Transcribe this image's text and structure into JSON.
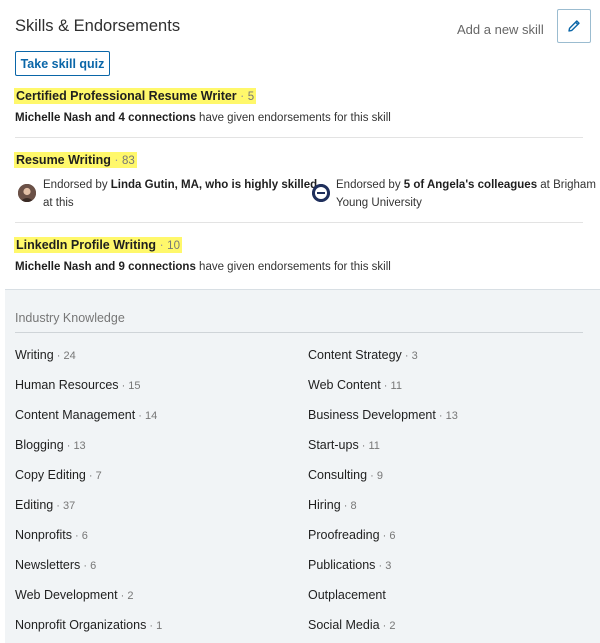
{
  "header": {
    "title": "Skills & Endorsements",
    "add_skill": "Add a new skill",
    "quiz_button": "Take skill quiz"
  },
  "top_skills": [
    {
      "name": "Certified Professional Resume Writer",
      "count": "5",
      "endorsement_names": "Michelle Nash and 4 connections",
      "endorsement_text": " have given endorsements for this skill"
    },
    {
      "name": "Resume Writing",
      "count": "83",
      "endorsers": [
        {
          "prefix": "Endorsed by ",
          "bold": "Linda Gutin, MA, who is highly skilled",
          "line2": "at this"
        },
        {
          "prefix": "Endorsed by ",
          "bold": "5 of Angela's colleagues",
          "suffix": " at Brigham",
          "line2": "Young University"
        }
      ]
    },
    {
      "name": "LinkedIn Profile Writing",
      "count": "10",
      "endorsement_names": "Michelle Nash and 9 connections",
      "endorsement_text": " have given endorsements for this skill"
    }
  ],
  "industry": {
    "label": "Industry Knowledge",
    "left": [
      {
        "name": "Writing",
        "count": "24"
      },
      {
        "name": "Human Resources",
        "count": "15"
      },
      {
        "name": "Content Management",
        "count": "14"
      },
      {
        "name": "Blogging",
        "count": "13"
      },
      {
        "name": "Copy Editing",
        "count": "7"
      },
      {
        "name": "Editing",
        "count": "37"
      },
      {
        "name": "Nonprofits",
        "count": "6"
      },
      {
        "name": "Newsletters",
        "count": "6"
      },
      {
        "name": "Web Development",
        "count": "2"
      },
      {
        "name": "Nonprofit Organizations",
        "count": "1"
      }
    ],
    "right": [
      {
        "name": "Content Strategy",
        "count": "3"
      },
      {
        "name": "Web Content",
        "count": "11"
      },
      {
        "name": "Business Development",
        "count": "13"
      },
      {
        "name": "Start-ups",
        "count": "11"
      },
      {
        "name": "Consulting",
        "count": "9"
      },
      {
        "name": "Hiring",
        "count": "8"
      },
      {
        "name": "Proofreading",
        "count": "6"
      },
      {
        "name": "Publications",
        "count": "3"
      },
      {
        "name": "Outplacement",
        "count": ""
      },
      {
        "name": "Social Media",
        "count": "2"
      }
    ]
  },
  "colors": {
    "highlight": "#fff86b",
    "accent": "#0a66a8",
    "panel_bg": "#f1f4f6"
  },
  "icons": {
    "edit": "pencil-icon",
    "endorser1": "avatar-photo",
    "endorser2": "byu-logo-icon"
  }
}
